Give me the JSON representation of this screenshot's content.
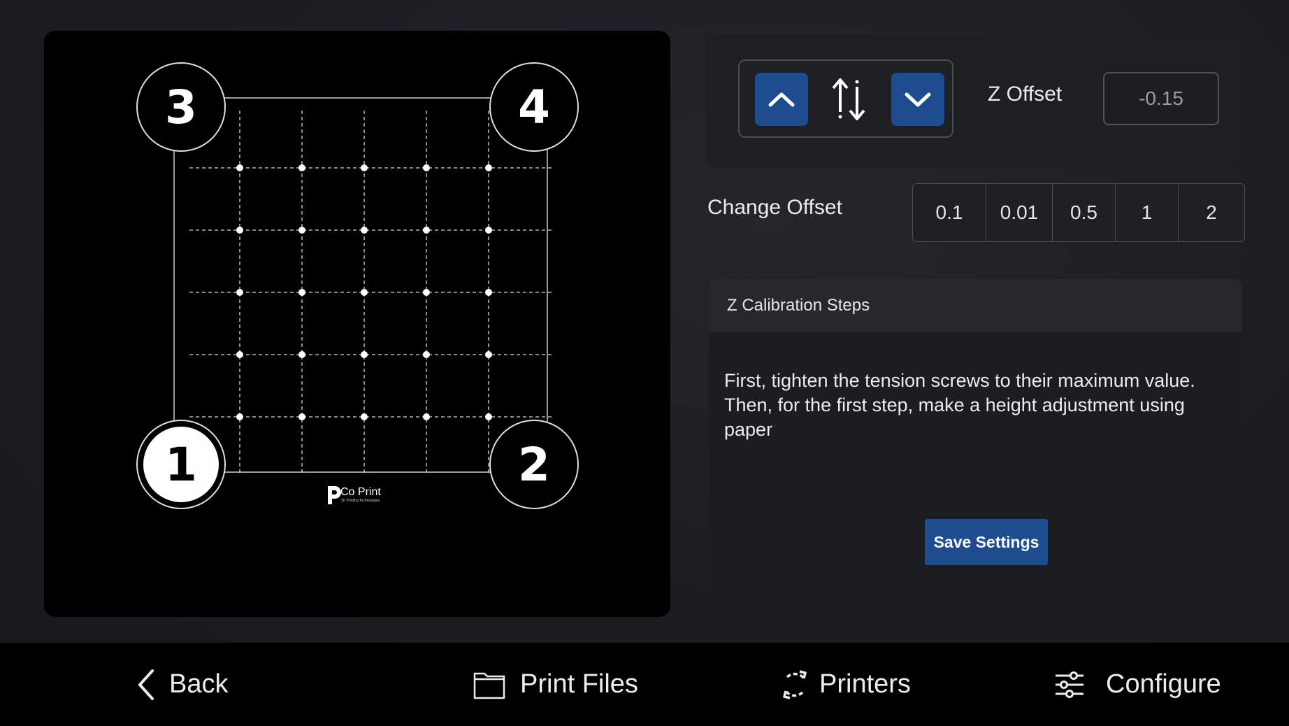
{
  "bed": {
    "corners": [
      {
        "id": "3",
        "label": "3",
        "active": false
      },
      {
        "id": "4",
        "label": "4",
        "active": false
      },
      {
        "id": "1",
        "label": "1",
        "active": true
      },
      {
        "id": "2",
        "label": "2",
        "active": false
      }
    ],
    "logo_text": "Co Print",
    "logo_sub": "3D Printing Technologies",
    "probe_grid": {
      "rows": 5,
      "cols": 5
    }
  },
  "z_offset": {
    "label": "Z Offset",
    "value": "-0.15"
  },
  "change_offset": {
    "label": "Change Offset",
    "steps": [
      "0.1",
      "0.01",
      "0.5",
      "1",
      "2"
    ],
    "selected": "0.5"
  },
  "calibration": {
    "title": "Z Calibration Steps",
    "text": "First, tighten the tension screws to their maximum value. Then, for the first step, make a height adjustment using paper",
    "save_label": "Save Settings"
  },
  "nav": {
    "back": "Back",
    "print_files": "Print Files",
    "printers": "Printers",
    "configure": "Configure"
  },
  "colors": {
    "accent": "#1d4d8e",
    "panel": "#000000",
    "background": "#1a1d21"
  }
}
